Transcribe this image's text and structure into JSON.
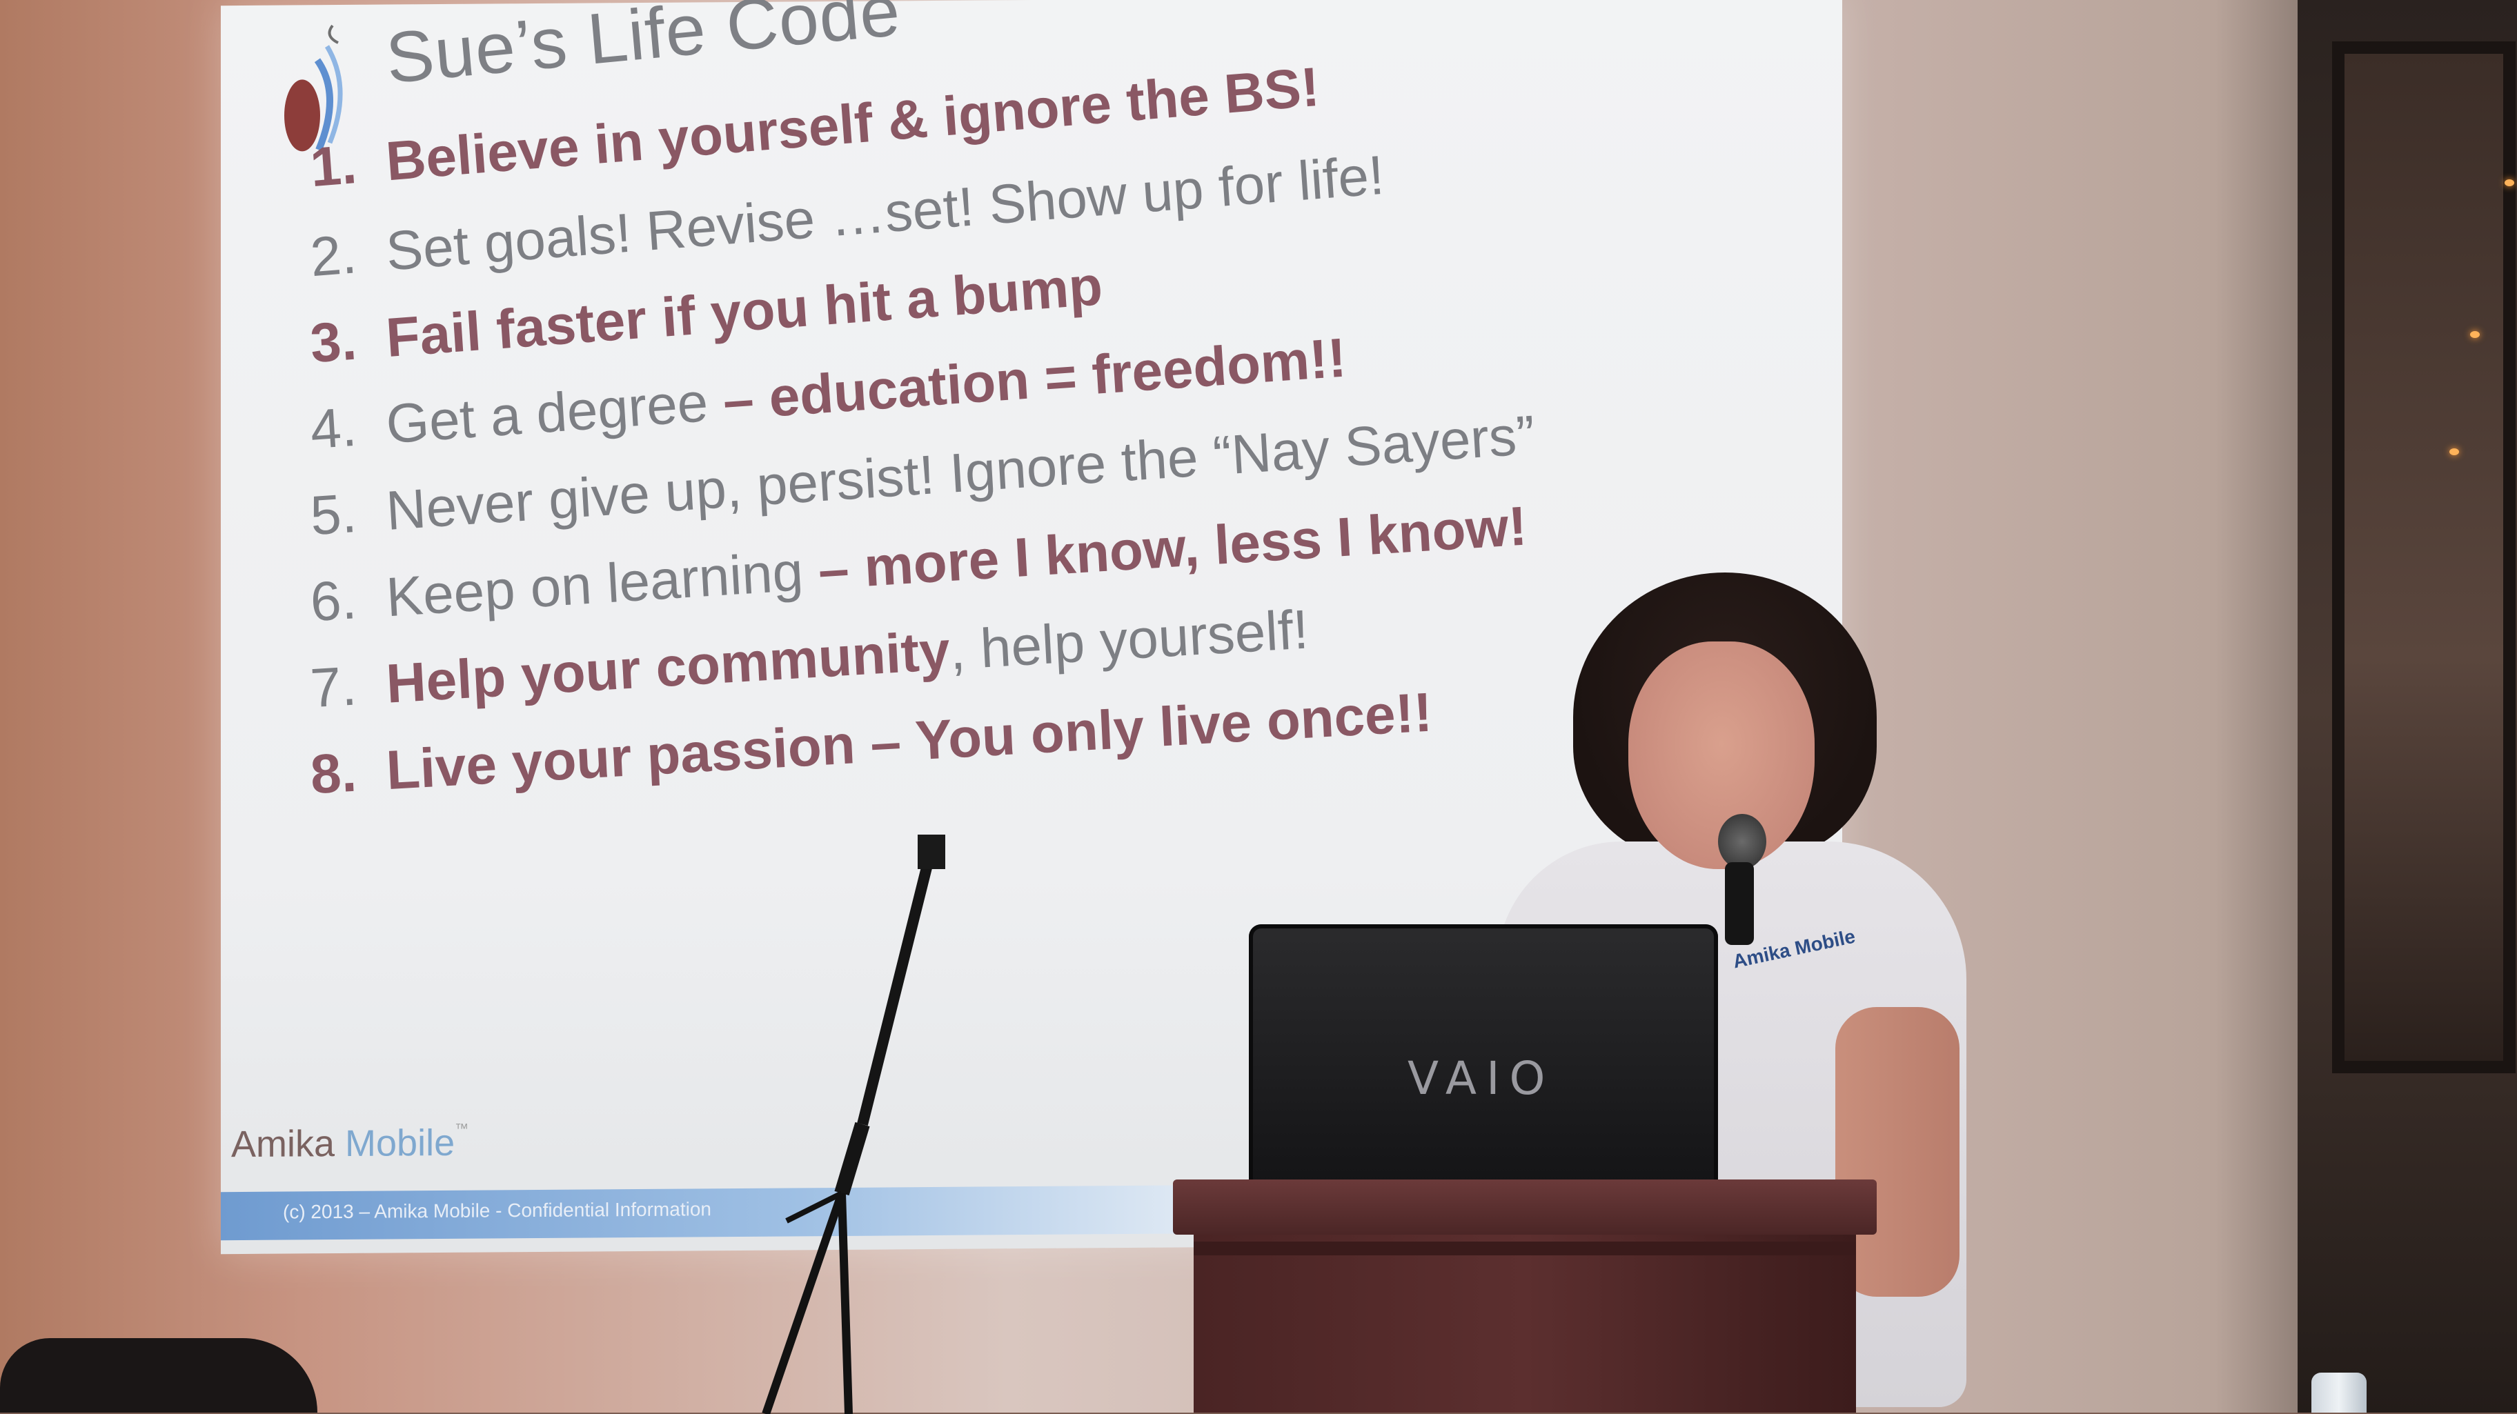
{
  "slide": {
    "title": "Sue’s Life Code",
    "items": [
      {
        "num": "1.",
        "pre": "",
        "em": "Believe in yourself & ignore the BS!",
        "post": ""
      },
      {
        "num": "2.",
        "pre": "Set goals! Revise …set! Show up for life!",
        "em": "",
        "post": ""
      },
      {
        "num": "3.",
        "pre": "",
        "em": "Fail faster if you hit a bump",
        "post": ""
      },
      {
        "num": "4.",
        "pre": "Get a degree ",
        "em": "– education = freedom!!",
        "post": ""
      },
      {
        "num": "5.",
        "pre": "Never give up, persist! Ignore the “Nay Sayers”",
        "em": "",
        "post": ""
      },
      {
        "num": "6.",
        "pre": "Keep on learning ",
        "em": "– more I know, less I know!",
        "post": ""
      },
      {
        "num": "7.",
        "pre": "",
        "em": "Help your community",
        "post": ", help yourself!"
      },
      {
        "num": "8.",
        "pre": "",
        "em": "Live your passion – You only live once!!",
        "post": ""
      }
    ],
    "brand_amika": "Amika",
    "brand_mobile": "Mobile",
    "brand_tm": "™",
    "footer": "(c) 2013 – Amika Mobile  - Confidential Information"
  },
  "laptop_brand": "VAIO",
  "shirt_logo": "Amika Mobile"
}
